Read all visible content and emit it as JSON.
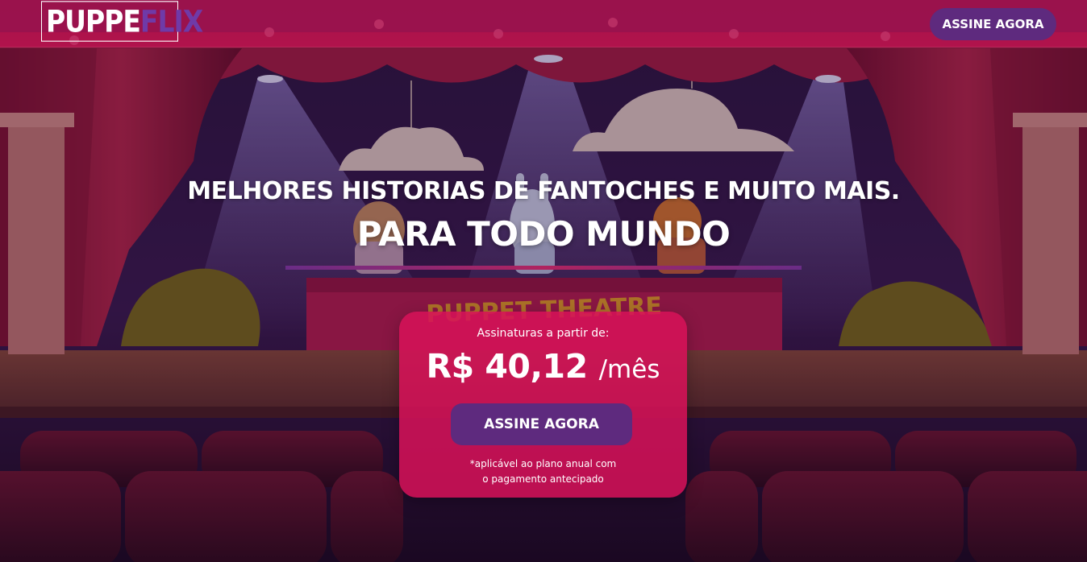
{
  "header": {
    "logo_part1": "PUPPE",
    "logo_part2": "FLIX",
    "cta_label": "ASSINE AGORA"
  },
  "hero": {
    "headline": "MELHORES HISTORIAS DE FANTOCHES E MUITO MAIS.",
    "subhead": "PARA TODO MUNDO"
  },
  "pricing": {
    "intro": "Assinaturas a partir de:",
    "price": "R$ 40,12",
    "period": "/mês",
    "cta_label": "ASSINE AGORA",
    "note_line1": "*aplicável ao plano anual com",
    "note_line2": "o pagamento antecipado"
  },
  "background": {
    "illustration": "puppet-theatre-stage",
    "sign_text": "PUPPET THEATRE"
  },
  "colors": {
    "header_bg": "#c81455",
    "accent_purple": "#5e2a7e",
    "card_bg": "#d71258",
    "logo_accent": "#6f3aa8"
  }
}
